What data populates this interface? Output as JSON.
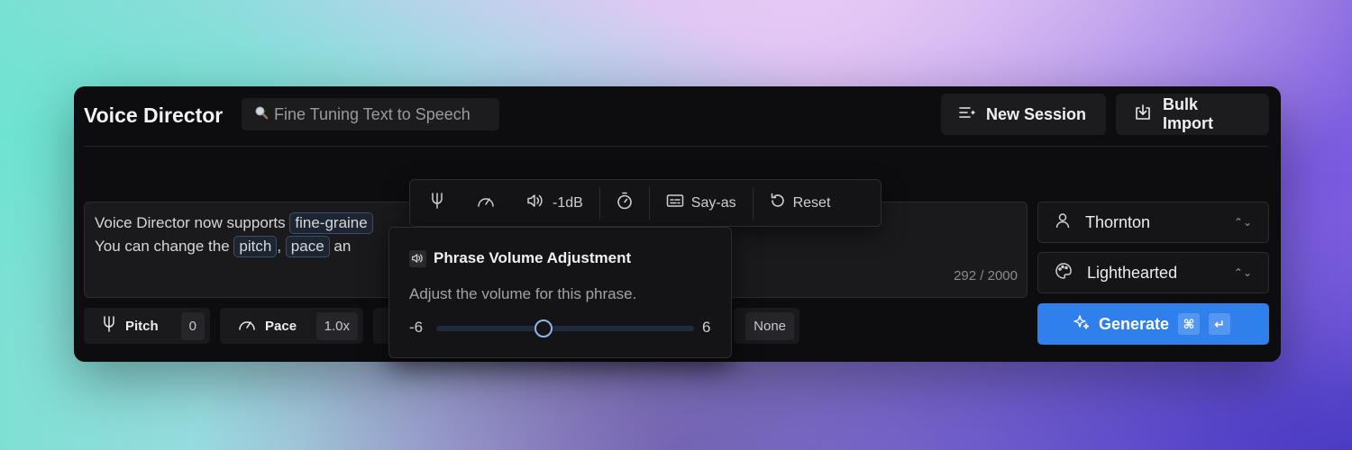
{
  "app": {
    "title": "Voice Director",
    "search_chip": "Fine Tuning Text to Speech",
    "new_session_label": "New Session",
    "bulk_import_label": "Bulk Import"
  },
  "editor": {
    "line1_prefix": "Voice Director now supports",
    "line1_token": "fine-graine",
    "line2_prefix": "You can change the",
    "token_pitch": "pitch",
    "comma": ",",
    "token_pace": "pace",
    "line2_suffix": "an",
    "counter": "292 / 2000"
  },
  "params": {
    "pitch_label": "Pitch",
    "pitch_value": "0",
    "pace_label": "Pace",
    "pace_value": "1.0x",
    "say_as_value": "None"
  },
  "toolbar": {
    "volume_label": "-1dB",
    "say_as_label": "Say-as",
    "reset_label": "Reset"
  },
  "popover": {
    "title": "Phrase Volume Adjustment",
    "description": "Adjust the volume for this phrase.",
    "min_label": "-6",
    "max_label": "6",
    "min": -6,
    "max": 6,
    "value": -1
  },
  "right_panel": {
    "voice": "Thornton",
    "mood": "Lighthearted",
    "generate_label": "Generate",
    "shortcut_cmd": "⌘",
    "shortcut_enter": "↵"
  },
  "colors": {
    "accent": "#2f80ed",
    "window_bg": "#0d0d0f",
    "slider_thumb": "#8fb6ea"
  }
}
